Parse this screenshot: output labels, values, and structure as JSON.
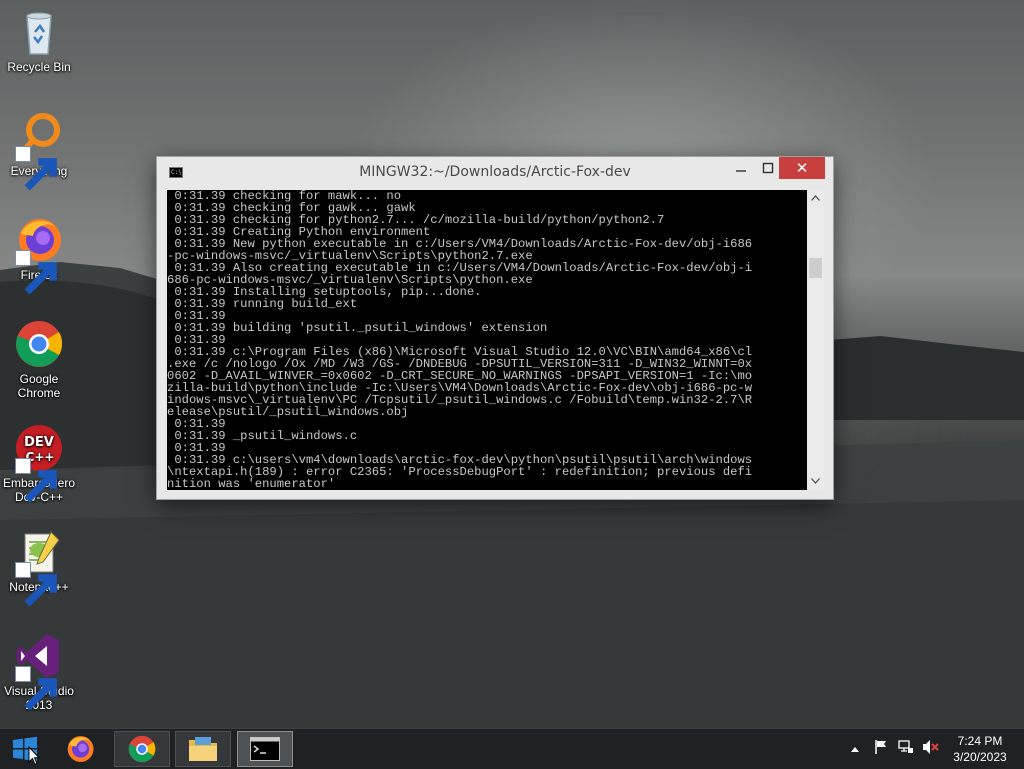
{
  "desktop": {
    "icons": [
      {
        "name": "recycle-bin",
        "label_lines": [
          "Recycle Bin"
        ]
      },
      {
        "name": "everything",
        "label_lines": [
          "Everything"
        ]
      },
      {
        "name": "firefox",
        "label_lines": [
          "Firefox"
        ]
      },
      {
        "name": "google-chrome",
        "label_lines": [
          "Google",
          "Chrome"
        ]
      },
      {
        "name": "embarcadero-dev-cpp",
        "label_lines": [
          "Embarcadero",
          "Dev-C++"
        ]
      },
      {
        "name": "notepad-plus-plus",
        "label_lines": [
          "Notepad++"
        ]
      },
      {
        "name": "visual-studio-2013",
        "label_lines": [
          "Visual Studio",
          "2013"
        ]
      }
    ]
  },
  "console_window": {
    "title": "MINGW32:~/Downloads/Arctic-Fox-dev",
    "icon_text": "C:\\_",
    "close_glyph": "✕",
    "lines": [
      " 0:31.39 checking for mawk... no",
      " 0:31.39 checking for gawk... gawk",
      " 0:31.39 checking for python2.7... /c/mozilla-build/python/python2.7",
      " 0:31.39 Creating Python environment",
      " 0:31.39 New python executable in c:/Users/VM4/Downloads/Arctic-Fox-dev/obj-i686",
      "-pc-windows-msvc/_virtualenv\\Scripts\\python2.7.exe",
      " 0:31.39 Also creating executable in c:/Users/VM4/Downloads/Arctic-Fox-dev/obj-i",
      "686-pc-windows-msvc/_virtualenv\\Scripts\\python.exe",
      " 0:31.39 Installing setuptools, pip...done.",
      " 0:31.39 running build_ext",
      " 0:31.39",
      " 0:31.39 building 'psutil._psutil_windows' extension",
      " 0:31.39",
      " 0:31.39 c:\\Program Files (x86)\\Microsoft Visual Studio 12.0\\VC\\BIN\\amd64_x86\\cl",
      ".exe /c /nologo /Ox /MD /W3 /GS- /DNDEBUG -DPSUTIL_VERSION=311 -D_WIN32_WINNT=0x",
      "0602 -D_AVAIL_WINVER_=0x0602 -D_CRT_SECURE_NO_WARNINGS -DPSAPI_VERSION=1 -Ic:\\mo",
      "zilla-build\\python\\include -Ic:\\Users\\VM4\\Downloads\\Arctic-Fox-dev\\obj-i686-pc-w",
      "indows-msvc\\_virtualenv\\PC /Tcpsutil/_psutil_windows.c /Fobuild\\temp.win32-2.7\\R",
      "elease\\psutil/_psutil_windows.obj",
      " 0:31.39",
      " 0:31.39 _psutil_windows.c",
      " 0:31.39",
      " 0:31.39 c:\\users\\vm4\\downloads\\arctic-fox-dev\\python\\psutil\\psutil\\arch\\windows",
      "\\ntextapi.h(189) : error C2365: 'ProcessDebugPort' : redefinition; previous defi",
      "nition was 'enumerator'"
    ]
  },
  "taskbar": {
    "apps": [
      "start-button",
      "firefox",
      "google-chrome",
      "file-explorer",
      "mingw32-console"
    ],
    "clock": {
      "time": "7:24 PM",
      "date": "3/20/2023"
    }
  },
  "colors": {
    "close_button": "#c8403d",
    "console_bg": "#000000",
    "console_text": "#c8c8c8",
    "taskbar_bg": "#1e2224"
  }
}
